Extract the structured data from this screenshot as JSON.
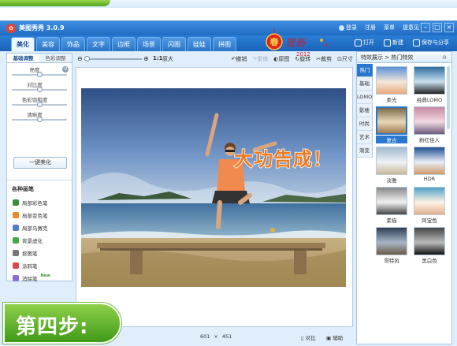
{
  "window": {
    "title": "美图秀秀 3.0.9",
    "links": [
      "登录",
      "注册",
      "菜单",
      "提意见"
    ]
  },
  "festive": {
    "char": "春",
    "year": "2012"
  },
  "tabs": [
    "美化",
    "美容",
    "饰品",
    "文字",
    "边框",
    "场景",
    "闪图",
    "娃娃",
    "拼图"
  ],
  "active_tab": "美化",
  "top_actions": [
    "打开",
    "新建",
    "保存与分享"
  ],
  "left_panel": {
    "subtabs": [
      "基础调整",
      "色彩调整"
    ],
    "sliders": [
      {
        "label": "亮度",
        "value": 0.5
      },
      {
        "label": "对比度",
        "value": 0.5
      },
      {
        "label": "色彩饱和度",
        "value": 0.5
      },
      {
        "label": "清晰度",
        "value": 0.5
      }
    ],
    "one_click": "一键美化",
    "brush_title": "各种画笔",
    "brushes": [
      {
        "label": "局部彩色笔",
        "color": "#3a8f3a"
      },
      {
        "label": "局部变色笔",
        "color": "#e38a2a"
      },
      {
        "label": "局部马赛克",
        "color": "#4f7fc9"
      },
      {
        "label": "背景虚化",
        "color": "#48a848"
      },
      {
        "label": "抠图笔",
        "color": "#777777"
      },
      {
        "label": "涂鸦笔",
        "color": "#d64a4a"
      },
      {
        "label": "消除笔",
        "color": "#8a6fd0"
      }
    ],
    "new_tag": "New"
  },
  "toolbar": {
    "zoom_out": "⊖",
    "zoom_in": "⊕",
    "zoom_level": 0.0,
    "ratio": "1:1",
    "original_size": "原大",
    "actions": [
      {
        "label": "撤销",
        "glyph": "↶",
        "enabled": true
      },
      {
        "label": "重做",
        "glyph": "↷",
        "enabled": false
      },
      {
        "label": "原图",
        "glyph": "◐",
        "enabled": true
      },
      {
        "label": "旋转",
        "glyph": "↻",
        "enabled": true
      },
      {
        "label": "裁剪",
        "glyph": "✂",
        "enabled": true
      },
      {
        "label": "尺寸",
        "glyph": "⊡",
        "enabled": true
      }
    ]
  },
  "canvas": {
    "overlay_text": "大功告成！"
  },
  "status": {
    "width": "601",
    "times": "×",
    "height": "451",
    "compare": "对比",
    "assist": "辅助"
  },
  "right_panel": {
    "header": "特效展示 > 热门特效",
    "close": "⊖",
    "categories": [
      "热门",
      "基础",
      "LOMO",
      "影楼",
      "时尚",
      "艺术",
      "渐变"
    ],
    "active_category": "热门",
    "effects": [
      "柔光",
      "经典LOMO",
      "复古",
      "粉红佳人",
      "淡雅",
      "HDR",
      "素描",
      "阿宝色",
      "哥特风",
      "黑白色"
    ],
    "selected_effect": "复古"
  },
  "step": "第四步:"
}
